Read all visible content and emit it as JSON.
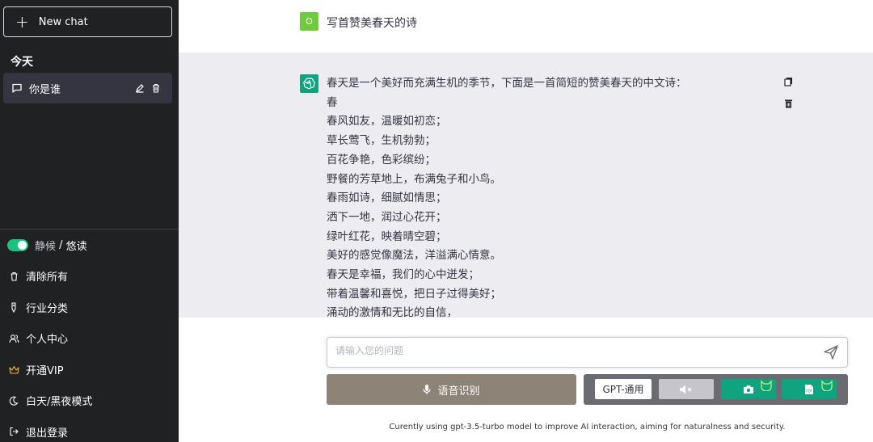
{
  "sidebar": {
    "new_chat_label": "New chat",
    "section_title": "今天",
    "chat_item_label": "你是谁",
    "mode_label_a": "静候",
    "mode_sep": " / ",
    "mode_label_b": "悠读",
    "menu": {
      "clear_all": "清除所有",
      "industry": "行业分类",
      "profile": "个人中心",
      "vip": "开通VIP",
      "day_night": "白天/黑夜模式",
      "logout": "退出登录"
    }
  },
  "user_message": {
    "avatar_letter": "O",
    "text": "写首赞美春天的诗"
  },
  "ai_message": {
    "lines": [
      "春天是一个美好而充满生机的季节，下面是一首简短的赞美春天的中文诗：",
      "春",
      "春风如友，温暖如初恋；",
      "草长莺飞，生机勃勃；",
      "百花争艳，色彩缤纷；",
      "野餐的芳草地上，布满兔子和小鸟。",
      "春雨如诗，细腻如情思；",
      "洒下一地，润过心花开；",
      "绿叶红花，映着晴空碧；",
      "美好的感觉像魔法，洋溢满心情意。",
      "春天是幸福，我们的心中迸发；",
      "带着温馨和喜悦，把日子过得美好；",
      "涌动的激情和无比的自信，"
    ]
  },
  "input": {
    "placeholder": "请输入您的问题",
    "value": ""
  },
  "voice_button_label": "语音识别",
  "model_button_label": "GPT-通用",
  "footer_text": "Curently using gpt-3.5-turbo model to improve AI interaction, aiming for naturalness and security.",
  "colors": {
    "sidebar_bg": "#202123",
    "accent_green": "#10a37f",
    "toggle_green": "#19c37d",
    "voice_button": "#8d8377",
    "tool_panel": "#6b6b72",
    "user_avatar": "#6ecb3c",
    "vip_icon": "#f0b43c"
  },
  "icons": {
    "new_chat": "plus-icon",
    "chat_item": "message-icon",
    "edit": "pencil-icon",
    "delete": "trash-icon",
    "clear_all": "trash-icon",
    "industry": "tag-icon",
    "profile": "users-icon",
    "vip": "crown-icon",
    "day_night": "moon-icon",
    "logout": "logout-icon",
    "copy": "copy-icon",
    "delete_msg": "trash-icon",
    "send": "send-icon",
    "voice": "microphone-icon",
    "mute": "speaker-mute-icon",
    "camera": "camera-icon",
    "pdf": "pdf-icon",
    "corner": "cat-corner-icon"
  }
}
